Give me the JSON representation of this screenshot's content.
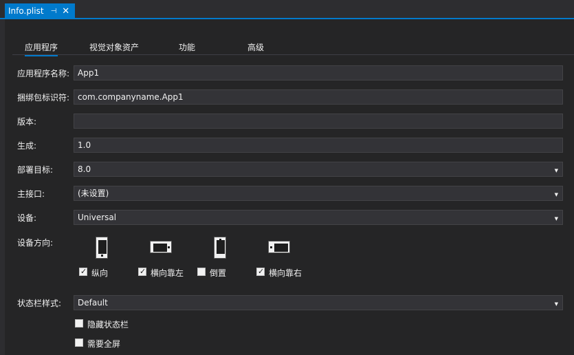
{
  "document_tab": {
    "title": "Info.plist",
    "pin_icon": "⊣",
    "close_icon": "✕"
  },
  "page_tabs": [
    {
      "label": "应用程序",
      "active": true
    },
    {
      "label": "视觉对象资产",
      "active": false
    },
    {
      "label": "功能",
      "active": false
    },
    {
      "label": "高级",
      "active": false
    }
  ],
  "fields": {
    "app_name": {
      "label": "应用程序名称:",
      "value": "App1"
    },
    "bundle_id": {
      "label": "捆绑包标识符:",
      "value": "com.companyname.App1"
    },
    "version": {
      "label": "版本:",
      "value": ""
    },
    "build": {
      "label": "生成:",
      "value": "1.0"
    },
    "deployment_target": {
      "label": "部署目标:",
      "value": "8.0"
    },
    "main_interface": {
      "label": "主接口:",
      "value": "(未设置)"
    },
    "devices": {
      "label": "设备:",
      "value": "Universal"
    },
    "status_bar_style": {
      "label": "状态栏样式:",
      "value": "Default"
    }
  },
  "orientation": {
    "label": "设备方向:",
    "options": [
      {
        "label": "纵向",
        "checked": true,
        "icon": "phone-portrait-icon"
      },
      {
        "label": "横向靠左",
        "checked": true,
        "icon": "phone-landscape-icon"
      },
      {
        "label": "倒置",
        "checked": false,
        "icon": "phone-portrait-icon"
      },
      {
        "label": "横向靠右",
        "checked": true,
        "icon": "phone-landscape-icon"
      }
    ]
  },
  "status_bar_options": [
    {
      "label": "隐藏状态栏",
      "checked": false
    },
    {
      "label": "需要全屏",
      "checked": false
    }
  ],
  "glyphs": {
    "dropdown": "▼",
    "check": "✓"
  },
  "colors": {
    "accent": "#007acc",
    "background": "#2d2d30",
    "input_bg": "#333337"
  }
}
